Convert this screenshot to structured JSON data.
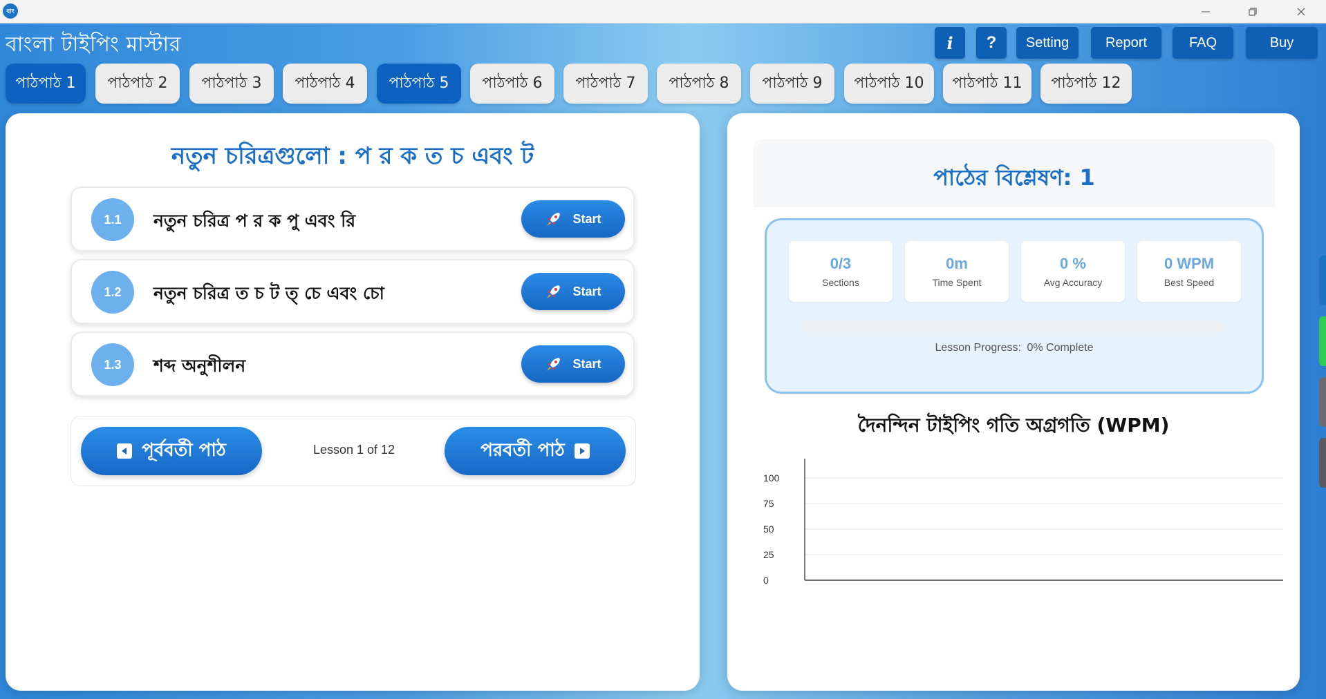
{
  "window": {
    "app_icon_text": "বাং",
    "minimize_icon": "minimize-icon",
    "restore_icon": "restore-icon",
    "close_icon": "close-icon"
  },
  "header": {
    "title": "বাংলা টাইপিং মাস্টার",
    "info_label": "i",
    "help_label": "?",
    "setting_label": "Setting",
    "report_label": "Report",
    "faq_label": "FAQ",
    "buy_label": "Buy"
  },
  "tabs": [
    {
      "label": "পাঠপাঠ 1",
      "active": true
    },
    {
      "label": "পাঠপাঠ 2",
      "active": false
    },
    {
      "label": "পাঠপাঠ 3",
      "active": false
    },
    {
      "label": "পাঠপাঠ 4",
      "active": false
    },
    {
      "label": "পাঠপাঠ 5",
      "active": true
    },
    {
      "label": "পাঠপাঠ 6",
      "active": false
    },
    {
      "label": "পাঠপাঠ 7",
      "active": false
    },
    {
      "label": "পাঠপাঠ 8",
      "active": false
    },
    {
      "label": "পাঠপাঠ 9",
      "active": false
    },
    {
      "label": "পাঠপাঠ 10",
      "active": false
    },
    {
      "label": "পাঠপাঠ 11",
      "active": false
    },
    {
      "label": "পাঠপাঠ 12",
      "active": false
    }
  ],
  "lesson": {
    "heading": "নতুন চরিত্রগুলো : প র ক ত চ এবং ট",
    "sections": [
      {
        "number": "1.1",
        "title": "নতুন চরিত্র প র ক পু এবং রি",
        "button": "Start"
      },
      {
        "number": "1.2",
        "title": "নতুন চরিত্র ত চ ট ত্ চে এবং চো",
        "button": "Start"
      },
      {
        "number": "1.3",
        "title": "শব্দ অনুশীলন",
        "button": "Start"
      }
    ],
    "prev_label": "পূর্ববর্তী পাঠ",
    "next_label": "পরবর্তী পাঠ",
    "lesson_count": "Lesson 1 of 12"
  },
  "analysis": {
    "title": "পাঠের বিশ্লেষণ: 1",
    "stats": [
      {
        "value": "0/3",
        "label": "Sections"
      },
      {
        "value": "0m",
        "label": "Time Spent"
      },
      {
        "value": "0 %",
        "label": "Avg Accuracy"
      },
      {
        "value": "0 WPM",
        "label": "Best Speed"
      }
    ],
    "progress_label": "Lesson Progress:",
    "progress_value": "0% Complete",
    "progress_fraction": 0
  },
  "colors": {
    "brand_blue": "#0e62bf",
    "accent_blue": "#1c6fc7",
    "stat_blue": "#6aa8e0"
  },
  "chart_data": {
    "type": "line",
    "title": "দৈনন্দিন টাইপিং গতি অগ্রগতি (WPM)",
    "xlabel": "",
    "ylabel": "",
    "ylim": [
      0,
      100
    ],
    "yticks": [
      100,
      75,
      50,
      25,
      0
    ],
    "series": [],
    "grid": true
  }
}
